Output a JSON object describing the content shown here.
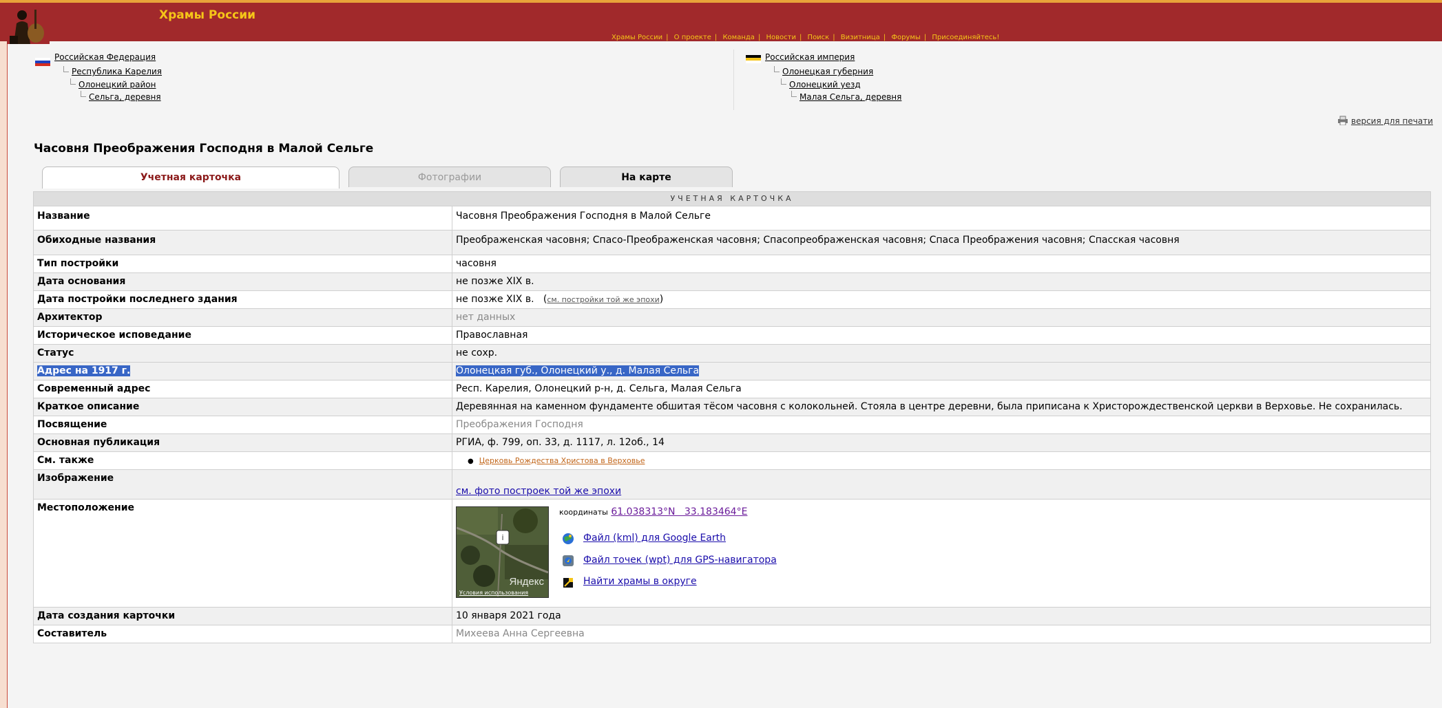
{
  "header": {
    "site_title": "Храмы России",
    "nav": [
      "Храмы России",
      "О проекте",
      "Команда",
      "Новости",
      "Поиск",
      "Визитница",
      "Форумы",
      "Присоединяйтесь!"
    ]
  },
  "breadcrumbs_modern": [
    "Российская Федерация",
    "Республика Карелия",
    "Олонецкий район",
    "Сельга, деревня"
  ],
  "breadcrumbs_historic": [
    "Российская империя",
    "Олонецкая губерния",
    "Олонецкий уезд",
    "Малая Сельга, деревня"
  ],
  "print_link": "версия для печати",
  "page_title": "Часовня Преображения Господня в Малой Сельге",
  "tabs": [
    "Учетная карточка",
    "Фотографии",
    "На карте"
  ],
  "card": {
    "caption": "УЧЕТНАЯ КАРТОЧКА",
    "rows": {
      "name": {
        "label": "Название",
        "value": "Часовня Преображения Господня в Малой Сельге"
      },
      "alt_names": {
        "label": "Обиходные названия",
        "value": "Преображенская часовня; Спасо-Преображенская часовня; Спасопреображенская часовня; Спаса Преображения часовня; Спасская часовня"
      },
      "type": {
        "label": "Тип постройки",
        "value": "часовня"
      },
      "founded": {
        "label": "Дата основания",
        "value": "не позже XIX в."
      },
      "built": {
        "label": "Дата постройки последнего здания",
        "value": "не позже XIX в.",
        "link": "см. постройки той же эпохи"
      },
      "architect": {
        "label": "Архитектор",
        "value": "нет данных"
      },
      "confession": {
        "label": "Историческое исповедание",
        "value": "Православная"
      },
      "status": {
        "label": "Статус",
        "value": "не сохр."
      },
      "address_1917": {
        "label": "Адрес на 1917 г.",
        "value": "Олонецкая губ., Олонецкий у., д. Малая Сельга"
      },
      "address_modern": {
        "label": "Современный адрес",
        "value": "Респ. Карелия, Олонецкий р-н, д. Сельга, Малая Сельга"
      },
      "description": {
        "label": "Краткое описание",
        "value": "Деревянная на каменном фундаменте обшитая тёсом часовня с колокольней. Стояла в центре деревни, была приписана к Христорождественской церкви в Верховье. Не сохранилась."
      },
      "dedication": {
        "label": "Посвящение",
        "value": "Преображения Господня"
      },
      "publication": {
        "label": "Основная публикация",
        "value": "РГИА, ф. 799, оп. 33, д. 1117, л. 12об., 14"
      },
      "see_also": {
        "label": "См. также",
        "value": "Церковь Рождества Христова в Верховье"
      },
      "image": {
        "label": "Изображение",
        "value": "см. фото построек той же эпохи"
      },
      "location": {
        "label": "Местоположение",
        "coords_label": "координаты",
        "coords": "61.038313°N   33.183464°E",
        "kml": "Файл (kml) для Google Earth",
        "wpt": "Файл точек (wpt) для GPS-навигатора",
        "nearby": "Найти храмы в округе",
        "map_brand": "Яндекс",
        "map_terms": "Условия использования"
      },
      "created": {
        "label": "Дата создания карточки",
        "value": "10 января 2021 года"
      },
      "author": {
        "label": "Составитель",
        "value": "Михеева Анна Сергеевна"
      }
    }
  }
}
